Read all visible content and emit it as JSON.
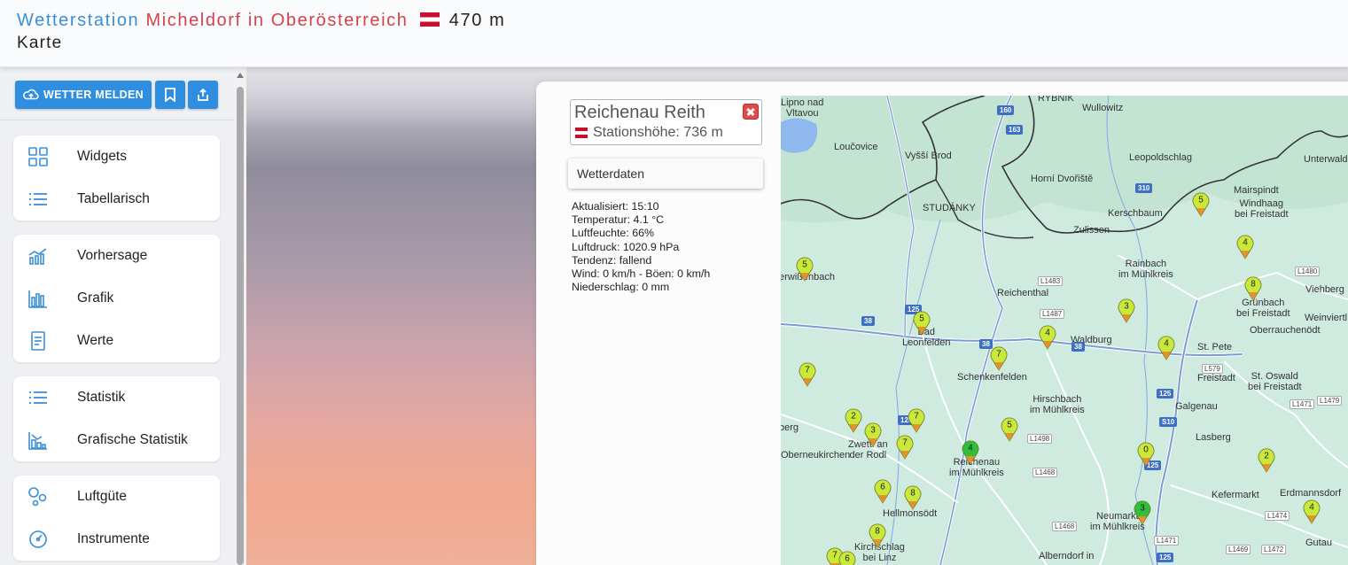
{
  "header": {
    "title_part1": "Wetterstation",
    "title_part2": "Micheldorf in Oberösterreich",
    "title_elevation": "470 m",
    "subtitle": "Karte"
  },
  "toolbar": {
    "report_label": "WETTER MELDEN"
  },
  "menu": {
    "groups": [
      {
        "items": [
          {
            "label": "Widgets",
            "icon": "widgets-grid-icon"
          },
          {
            "label": "Tabellarisch",
            "icon": "list-icon"
          }
        ]
      },
      {
        "items": [
          {
            "label": "Vorhersage",
            "icon": "forecast-chart-icon"
          },
          {
            "label": "Grafik",
            "icon": "bar-chart-icon"
          },
          {
            "label": "Werte",
            "icon": "document-icon"
          }
        ]
      },
      {
        "items": [
          {
            "label": "Statistik",
            "icon": "list-icon"
          },
          {
            "label": "Grafische Statistik",
            "icon": "stat-chart-icon"
          }
        ]
      },
      {
        "items": [
          {
            "label": "Luftgüte",
            "icon": "molecule-icon"
          },
          {
            "label": "Instrumente",
            "icon": "gauge-icon"
          }
        ]
      }
    ]
  },
  "station": {
    "name": "Reichenau Reith",
    "altitude": "Stationshöhe: 736 m"
  },
  "weather_tab": {
    "label": "Wetterdaten"
  },
  "weather": {
    "updated": "Aktualisiert: 15:10",
    "temperature": "Temperatur: 4.1 °C",
    "humidity": "Luftfeuchte: 66%",
    "pressure": "Luftdruck: 1020.9 hPa",
    "tendency": "Tendenz: fallend",
    "wind": "Wind: 0 km/h - Böen: 0 km/h",
    "precipitation": "Niederschlag: 0 mm"
  },
  "map": {
    "places": [
      {
        "text": "Lipno nad Vltavou",
        "l": "Lipno nad",
        "l2": "Vltavou"
      },
      {
        "text": "RYBNIK"
      },
      {
        "text": "Wullowitz"
      },
      {
        "text": "Loučovice"
      },
      {
        "text": "Vyšší Brod"
      },
      {
        "text": "Leopoldschlag"
      },
      {
        "text": "Unterwald"
      },
      {
        "text": "Horní Dvořiště"
      },
      {
        "text": "Mairspindt"
      },
      {
        "text": "Windhaag bei Freistadt",
        "l": "Windhaag",
        "l2": "bei Freistadt"
      },
      {
        "text": "STUDÁNKY"
      },
      {
        "text": "Kerschbaum"
      },
      {
        "text": "Zulissen"
      },
      {
        "text": "erwißenbach"
      },
      {
        "text": "Rainbach im Mühlkreis",
        "l": "Rainbach",
        "l2": "im Mühlkreis"
      },
      {
        "text": "Viehberg"
      },
      {
        "text": "Reichenthal"
      },
      {
        "text": "Grünbach bei Freistadt",
        "l": "Grünbach",
        "l2": "bei Freistadt"
      },
      {
        "text": "Weinviertl"
      },
      {
        "text": "Bad Leonfelden",
        "l": "Bad",
        "l2": "Leonfelden"
      },
      {
        "text": "Oberrauchenödt"
      },
      {
        "text": "Waldburg"
      },
      {
        "text": "St. Pete"
      },
      {
        "text": "Schenkenfelden"
      },
      {
        "text": "Freistadt"
      },
      {
        "text": "St. Oswald bei Freistadt",
        "l": "St. Oswald",
        "l2": "bei Freistadt"
      },
      {
        "text": "Hirschbach im Mühlkreis",
        "l": "Hirschbach",
        "l2": "im Mühlkreis"
      },
      {
        "text": "Galgenau"
      },
      {
        "text": "berg"
      },
      {
        "text": "Zwettl an der Rodl",
        "l": "Zwettl an",
        "l2": "der Rodl"
      },
      {
        "text": "Oberneukirchen"
      },
      {
        "text": "Lasberg"
      },
      {
        "text": "Reichenau im Mühlkreis",
        "l": "Reichenau",
        "l2": "im Mühlkreis"
      },
      {
        "text": "Kefermarkt"
      },
      {
        "text": "Erdmannsdorf"
      },
      {
        "text": "Hellmonsödt"
      },
      {
        "text": "Neumarkt im Mühlkreis",
        "l": "Neumarkt",
        "l2": "im Mühlkreis"
      },
      {
        "text": "Gutau"
      },
      {
        "text": "Kirchschlag bei Linz",
        "l": "Kirchschlag",
        "l2": "bei Linz"
      },
      {
        "text": "Alberndorf in",
        "l": "Alberndorf in"
      }
    ],
    "roads": [
      "160",
      "163",
      "310",
      "38",
      "38",
      "38",
      "125",
      "125",
      "125",
      "125",
      "126",
      "S10",
      "L1480",
      "L1483",
      "L1487",
      "L579",
      "L1471",
      "L1479",
      "L1498",
      "L1468",
      "L1468",
      "L1474",
      "L1471",
      "L1469",
      "L1472"
    ],
    "markers": [
      {
        "value": "5",
        "color": "#c9e83a"
      },
      {
        "value": "4",
        "color": "#c9e83a"
      },
      {
        "value": "8",
        "color": "#c9e83a"
      },
      {
        "value": "5",
        "color": "#c9e83a"
      },
      {
        "value": "5",
        "color": "#c9e83a"
      },
      {
        "value": "3",
        "color": "#c9e83a"
      },
      {
        "value": "4",
        "color": "#c9e83a"
      },
      {
        "value": "4",
        "color": "#c9e83a"
      },
      {
        "value": "7",
        "color": "#c9e83a"
      },
      {
        "value": "7",
        "color": "#c9e83a"
      },
      {
        "value": "2",
        "color": "#c9e83a"
      },
      {
        "value": "3",
        "color": "#c9e83a"
      },
      {
        "value": "7",
        "color": "#c9e83a"
      },
      {
        "value": "7",
        "color": "#c9e83a"
      },
      {
        "value": "5",
        "color": "#c9e83a"
      },
      {
        "value": "4",
        "color": "#2fbf3a"
      },
      {
        "value": "0",
        "color": "#c9e83a"
      },
      {
        "value": "2",
        "color": "#c9e83a"
      },
      {
        "value": "6",
        "color": "#c9e83a"
      },
      {
        "value": "8",
        "color": "#c9e83a"
      },
      {
        "value": "3",
        "color": "#2fbf3a"
      },
      {
        "value": "4",
        "color": "#c9e83a"
      },
      {
        "value": "8",
        "color": "#c9e83a"
      },
      {
        "value": "7",
        "color": "#c9e83a"
      },
      {
        "value": "6",
        "color": "#c9e83a"
      }
    ]
  }
}
